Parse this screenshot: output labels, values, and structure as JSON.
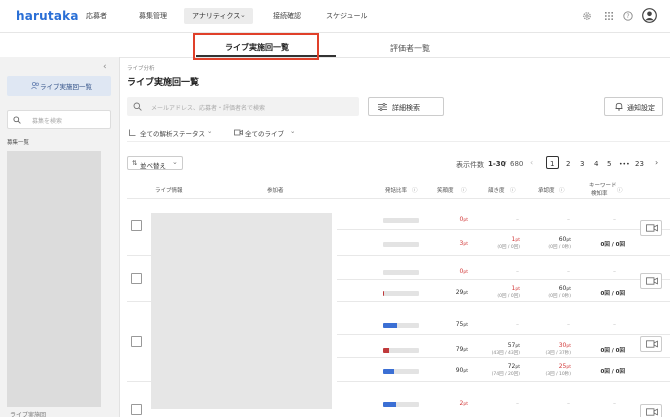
{
  "app": {
    "logo": "harutaka"
  },
  "nav": {
    "items": [
      "応募者",
      "募集管理",
      "接続確認",
      "スケジュール"
    ],
    "active": "アナリティクス"
  },
  "tabs": [
    "ライブ実施回一覧",
    "評価者一覧"
  ],
  "sidebar": {
    "active_item": "ライブ実施回一覧",
    "search_placeholder": "募集を検索",
    "section_label": "募集一覧",
    "footer_partial": "ライブ実施回"
  },
  "main": {
    "breadcrumb": "ライブ分析",
    "title": "ライブ実施回一覧",
    "search_placeholder": "メールアドレス、応募者・評価者名で検索",
    "advanced_search": "詳細検索",
    "notify_settings": "通知設定",
    "filters": [
      "全ての解析ステータス",
      "全てのライブ"
    ],
    "sort_label": "並べ替え",
    "count_label": "表示件数",
    "count_range": "1-30",
    "count_sep": "/",
    "count_total": "680",
    "pages": [
      "1",
      "2",
      "3",
      "4",
      "5",
      "•••",
      "23"
    ],
    "current_page": "1"
  },
  "table": {
    "headers": {
      "live_info": "ライブ情報",
      "participant": "参加者",
      "speech_ratio": "発話比率",
      "speaking": "笑顔度",
      "nod": "頷き度",
      "acceptance": "承認度",
      "keyword1": "キーワード",
      "keyword2": "検知率"
    },
    "rows": [
      {
        "ratio": 0.0,
        "color": "",
        "smile": "0",
        "nod": "–",
        "nod_sub": "",
        "accept": "–",
        "accept_sub": "",
        "kw": "–"
      },
      {
        "ratio": 0.0,
        "color": "",
        "smile": "3",
        "nod": "1",
        "nod_sub": "(0回 / 0回)",
        "accept": "60",
        "accept_sub": "(0回 / 0秒)",
        "kw": "0回 / 0回"
      },
      {
        "ratio": 0.0,
        "color": "",
        "smile": "0",
        "nod": "–",
        "nod_sub": "",
        "accept": "–",
        "accept_sub": "",
        "kw": "–"
      },
      {
        "ratio": 0.04,
        "color": "#c0393b",
        "smile": "29",
        "nod": "1",
        "nod_sub": "(0回 / 0回)",
        "accept": "60",
        "accept_sub": "(0回 / 0秒)",
        "kw": "0回 / 0回"
      },
      {
        "ratio": 0.38,
        "color": "#3b6fd4",
        "smile": "75",
        "nod": "–",
        "nod_sub": "",
        "accept": "–",
        "accept_sub": "",
        "kw": "–"
      },
      {
        "ratio": 0.18,
        "color": "#c0393b",
        "smile": "79",
        "nod": "57",
        "nod_sub": "(43回 / 43回)",
        "accept": "30",
        "accept_sub": "(3回 / 37秒)",
        "kw": "0回 / 0回"
      },
      {
        "ratio": 0.3,
        "color": "#3b6fd4",
        "smile": "90",
        "nod": "72",
        "nod_sub": "(74回 / 20回)",
        "accept": "25",
        "accept_sub": "(3回 / 10秒)",
        "kw": "0回 / 0回"
      },
      {
        "ratio": 0.36,
        "color": "#3b6fd4",
        "smile": "2",
        "nod": "–",
        "nod_sub": "",
        "accept": "–",
        "accept_sub": "",
        "kw": "–"
      }
    ],
    "unit": "pt"
  },
  "colors": {
    "brand": "#2a6fd6",
    "highlight": "#e0402a",
    "negative": "#d23a3a",
    "bar_blue": "#3b6fd4",
    "bar_red": "#c0393b"
  }
}
